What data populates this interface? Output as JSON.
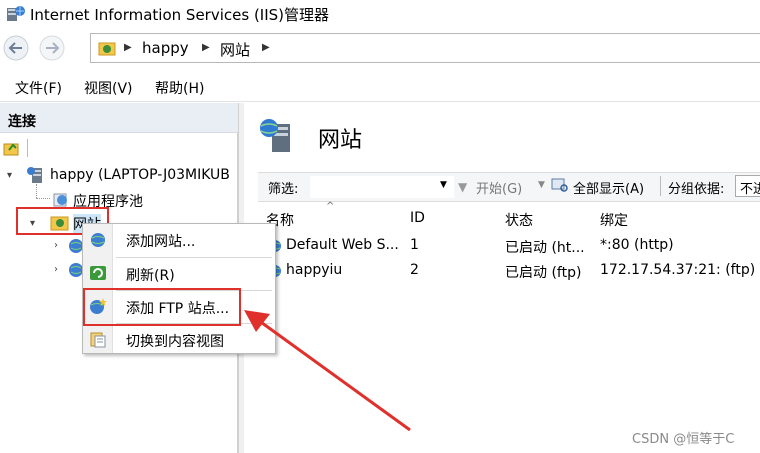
{
  "window": {
    "title": "Internet Information Services (IIS)管理器",
    "icon": "iis-manager-icon"
  },
  "address_bar": {
    "breadcrumbs": [
      "happy",
      "网站"
    ]
  },
  "menu": {
    "items": [
      "文件(F)",
      "视图(V)",
      "帮助(H)"
    ]
  },
  "connections": {
    "header": "连接",
    "tree": {
      "server": "happy (LAPTOP-J03MIKUB",
      "app_pools": "应用程序池",
      "sites": "网站"
    }
  },
  "context_menu": {
    "items": [
      {
        "label": "添加网站...",
        "icon": "globe-add-icon"
      },
      {
        "label": "刷新(R)",
        "icon": "refresh-icon"
      },
      {
        "label": "添加 FTP 站点...",
        "icon": "ftp-add-icon"
      },
      {
        "label": "切换到内容视图",
        "icon": "content-view-icon"
      }
    ]
  },
  "main": {
    "title": "网站",
    "filter": {
      "label": "筛选:",
      "start_label": "开始(G)",
      "show_all_label": "全部显示(A)",
      "group_by_label": "分组依据:",
      "group_by_value": "不进"
    },
    "table": {
      "columns": [
        "名称",
        "ID",
        "状态",
        "绑定"
      ],
      "rows": [
        {
          "name": "Default Web S...",
          "id": "1",
          "status": "已启动 (ht...",
          "binding": "*:80 (http)"
        },
        {
          "name": "happyiu",
          "id": "2",
          "status": "已启动 (ftp)",
          "binding": "172.17.54.37:21: (ftp)"
        }
      ]
    }
  },
  "watermark": "CSDN @恒等于C",
  "colors": {
    "highlight_red": "#e0302b",
    "header_bg": "#e9eef5"
  }
}
